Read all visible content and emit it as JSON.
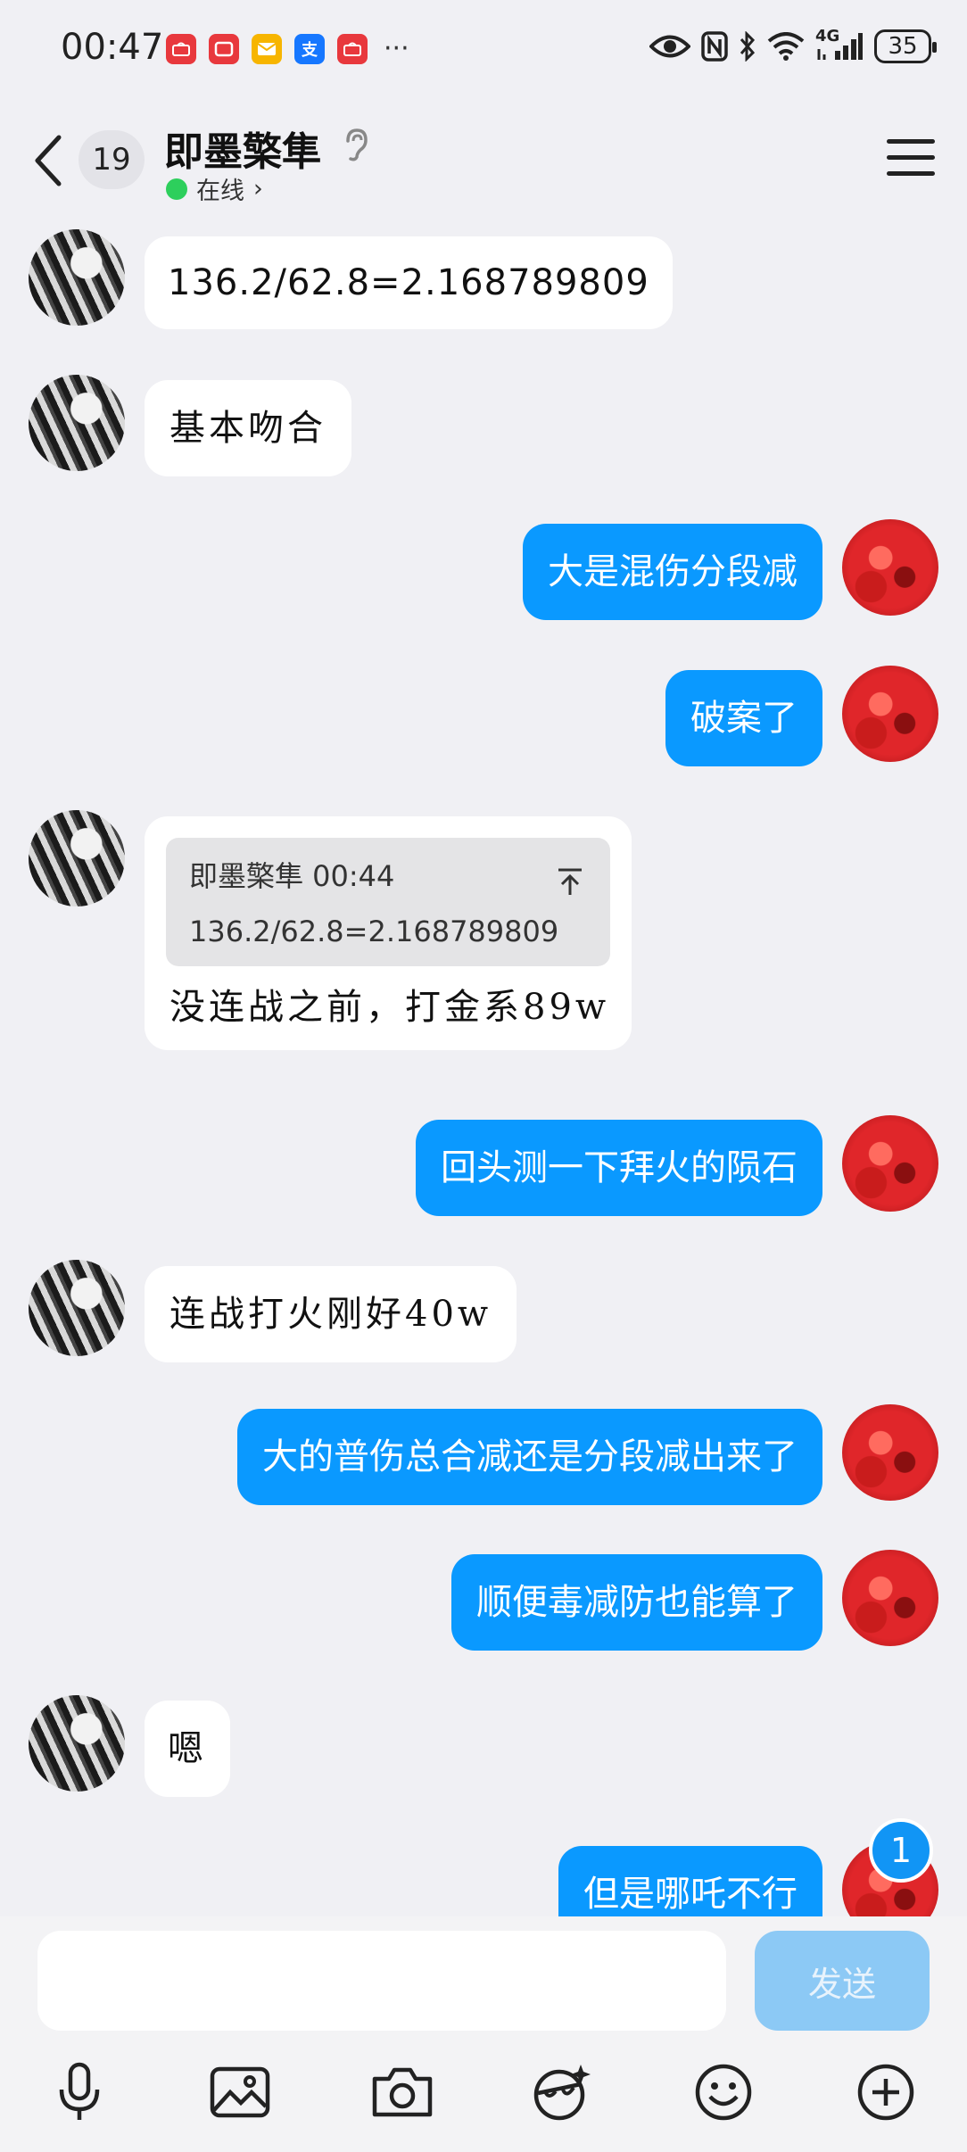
{
  "status_bar": {
    "time": "00:47",
    "battery": "35",
    "network": "4G",
    "notification_icons": [
      "huawei-app-icon",
      "huawei-video-icon",
      "mail-icon",
      "alipay-icon",
      "huawei-store-icon"
    ],
    "more": "···",
    "alipay_glyph": "支"
  },
  "header": {
    "unread_count": "19",
    "contact_name": "即墨檠隼",
    "status": "在线",
    "status_arrow": "›"
  },
  "messages": [
    {
      "side": "in",
      "text": "136.2/62.8=2.168789809"
    },
    {
      "side": "in",
      "text": "基本吻合"
    },
    {
      "side": "out",
      "text": "大是混伤分段减"
    },
    {
      "side": "out",
      "text": "破案了"
    },
    {
      "side": "in",
      "quote_sender_time": "即墨檠隼 00:44",
      "quote_text": "136.2/62.8=2.168789809",
      "text": "没连战之前，打金系89w"
    },
    {
      "side": "out",
      "text": "回头测一下拜火的陨石"
    },
    {
      "side": "in",
      "text": "连战打火刚好40w"
    },
    {
      "side": "out",
      "text": "大的普伤总合减还是分段减出来了"
    },
    {
      "side": "out",
      "text": "顺便毒减防也能算了"
    },
    {
      "side": "in",
      "text": "嗯"
    },
    {
      "side": "out",
      "text": "但是哪吒不行"
    }
  ],
  "new_message_badge": "1",
  "input": {
    "placeholder": "",
    "send_label": "发送"
  },
  "toolbar": [
    "microphone-icon",
    "image-icon",
    "camera-icon",
    "sticker-icon",
    "emoji-icon",
    "plus-icon"
  ],
  "colors": {
    "accent": "#0a99ff",
    "background": "#f0f0f4",
    "online": "#2dcf5c",
    "send_disabled": "#8cc9f5"
  }
}
